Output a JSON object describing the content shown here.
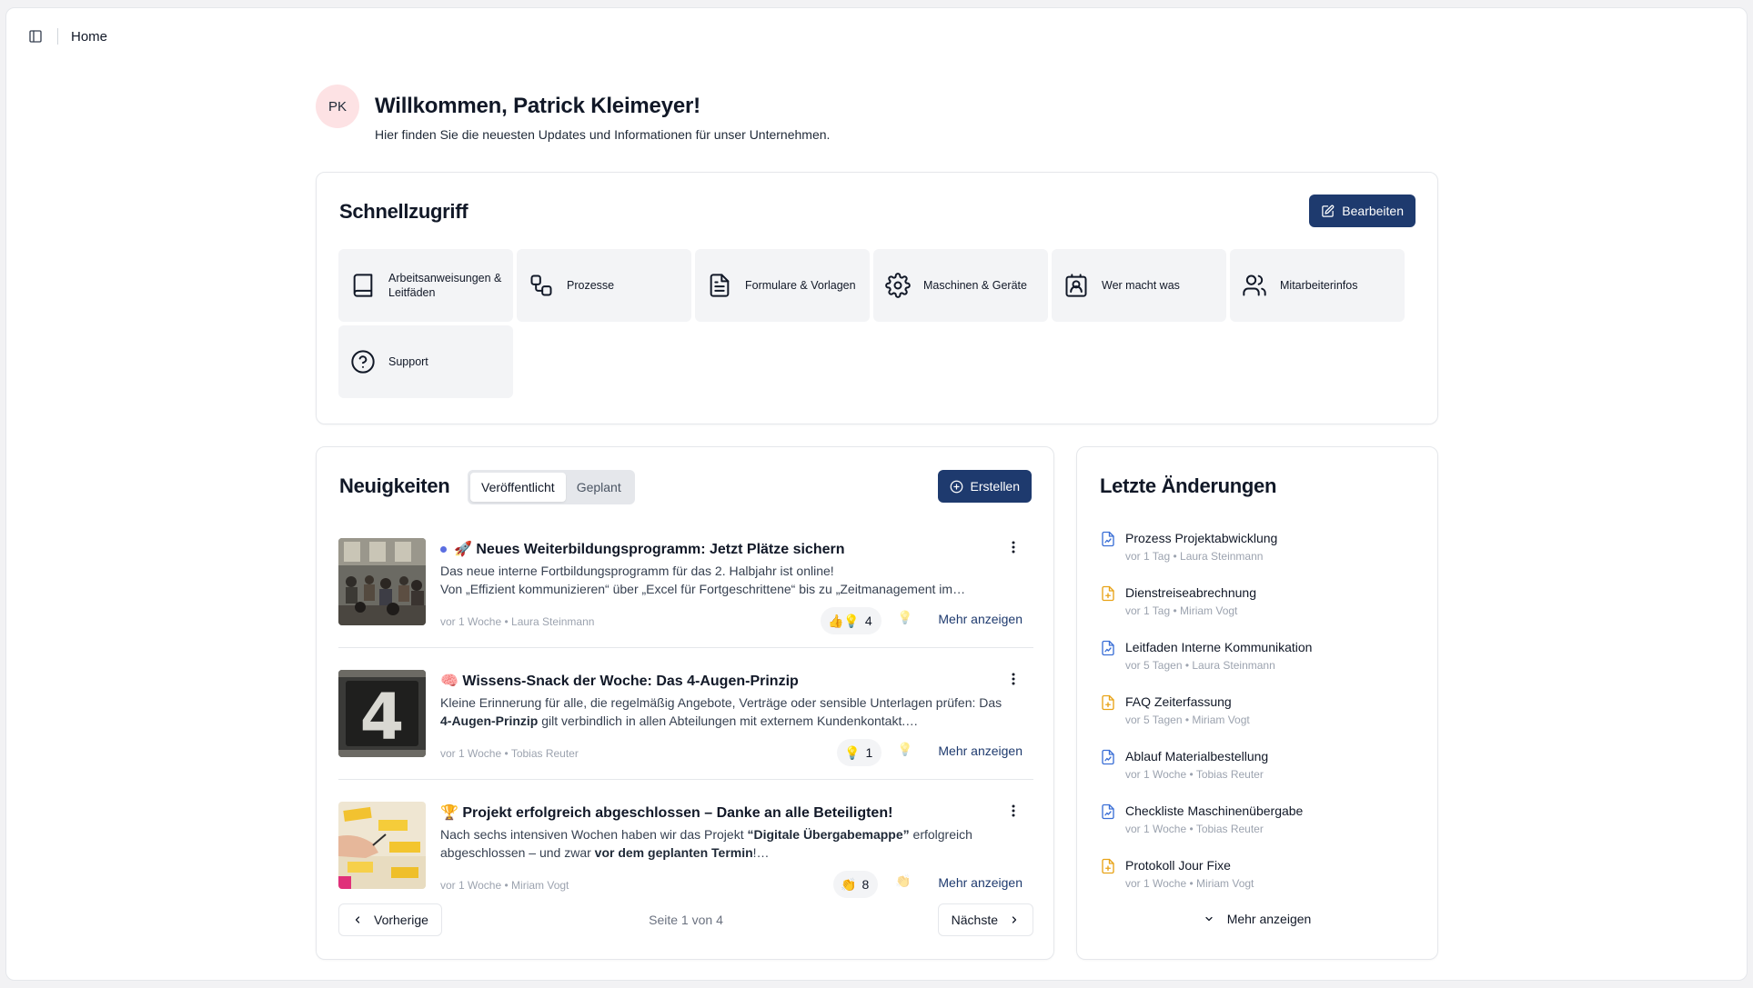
{
  "topbar": {
    "breadcrumb": "Home",
    "toggle_icon": "sidebar-toggle-icon"
  },
  "welcome": {
    "avatar_initials": "PK",
    "title": "Willkommen, Patrick Kleimeyer!",
    "subtitle": "Hier finden Sie die neuesten Updates und Informationen für unser Unternehmen."
  },
  "quick_access": {
    "title": "Schnellzugriff",
    "edit_label": "Bearbeiten",
    "tiles": [
      {
        "label": "Arbeitsanweisungen & Leitfäden",
        "icon": "book-icon"
      },
      {
        "label": "Prozesse",
        "icon": "workflow-icon"
      },
      {
        "label": "Formulare & Vorlagen",
        "icon": "file-text-icon"
      },
      {
        "label": "Maschinen & Geräte",
        "icon": "gear-icon"
      },
      {
        "label": "Wer macht was",
        "icon": "contact-card-icon"
      },
      {
        "label": "Mitarbeiterinfos",
        "icon": "users-icon"
      },
      {
        "label": "Support",
        "icon": "help-circle-icon"
      }
    ]
  },
  "news": {
    "title": "Neuigkeiten",
    "tabs": [
      {
        "label": "Veröffentlicht",
        "active": true
      },
      {
        "label": "Geplant",
        "active": false
      }
    ],
    "create_label": "Erstellen",
    "more_label": "Mehr anzeigen",
    "posts": [
      {
        "title": "🚀 Neues Weiterbildungsprogramm: Jetzt Plätze sichern",
        "unread": true,
        "line1": "Das neue interne Fortbildungsprogramm für das 2. Halbjahr ist online!",
        "line2": "Von „Effizient kommunizieren“ über „Excel für Fortgeschrittene“ bis zu „Zeitmanagement im…",
        "time": "vor 1 Woche",
        "author": "Laura Steinmann",
        "reaction_emoji": "👍💡",
        "reaction_count": "4",
        "add_reaction_emoji": "💡"
      },
      {
        "title": "🧠 Wissens-Snack der Woche: Das 4-Augen-Prinzip",
        "unread": false,
        "line1": "Kleine Erinnerung für alle, die regelmäßig Angebote, Verträge oder sensible Unterlagen prüfen: Das",
        "line2_bold": "4-Augen-Prinzip",
        "line2_rest": " gilt verbindlich in allen Abteilungen mit externem Kundenkontakt.…",
        "time": "vor 1 Woche",
        "author": "Tobias Reuter",
        "reaction_emoji": "💡",
        "reaction_count": "1",
        "add_reaction_emoji": "💡"
      },
      {
        "title": "🏆 Projekt erfolgreich abgeschlossen – Danke an alle Beteiligten!",
        "unread": false,
        "line1_pre": "Nach sechs intensiven Wochen haben wir das Projekt ",
        "line1_bold": "“Digitale Übergabemappe”",
        "line1_post": " erfolgreich",
        "line2_pre": "abgeschlossen – und zwar ",
        "line2_bold": "vor dem geplanten Termin",
        "line2_post": "!…",
        "time": "vor 1 Woche",
        "author": "Miriam Vogt",
        "reaction_emoji": "👏",
        "reaction_count": "8",
        "add_reaction_emoji": "👏"
      }
    ],
    "pagination": {
      "prev_label": "Vorherige",
      "next_label": "Nächste",
      "page_info": "Seite 1 von 4"
    }
  },
  "changes": {
    "title": "Letzte Änderungen",
    "more_label": "Mehr anzeigen",
    "items": [
      {
        "title": "Prozess Projektabwicklung",
        "time": "vor 1 Tag",
        "author": "Laura Steinmann",
        "icon": "document-blue-icon"
      },
      {
        "title": "Dienstreiseabrechnung",
        "time": "vor 1 Tag",
        "author": "Miriam Vogt",
        "icon": "document-plus-yellow-icon"
      },
      {
        "title": "Leitfaden Interne Kommunikation",
        "time": "vor 5 Tagen",
        "author": "Laura Steinmann",
        "icon": "document-blue-icon"
      },
      {
        "title": "FAQ Zeiterfassung",
        "time": "vor 5 Tagen",
        "author": "Miriam Vogt",
        "icon": "document-plus-yellow-icon"
      },
      {
        "title": "Ablauf Materialbestellung",
        "time": "vor 1 Woche",
        "author": "Tobias Reuter",
        "icon": "document-blue-icon"
      },
      {
        "title": "Checkliste Maschinenübergabe",
        "time": "vor 1 Woche",
        "author": "Tobias Reuter",
        "icon": "document-blue-icon"
      },
      {
        "title": "Protokoll Jour Fixe",
        "time": "vor 1 Woche",
        "author": "Miriam Vogt",
        "icon": "document-plus-yellow-icon"
      }
    ]
  },
  "colors": {
    "primary": "#1e3a6e",
    "doc_blue": "#3b6fd6",
    "doc_yellow": "#e8a317",
    "avatar_bg": "#fde2e4"
  }
}
